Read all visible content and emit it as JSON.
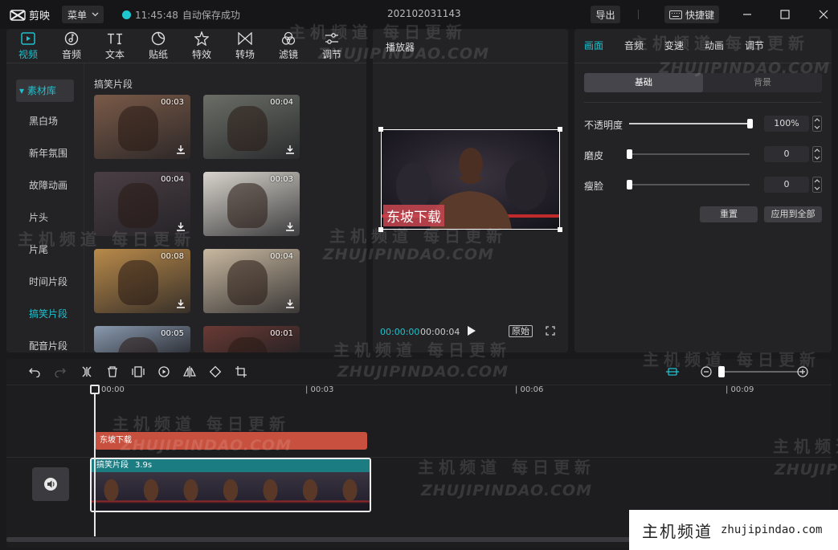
{
  "app": {
    "name": "剪映",
    "menu_label": "菜单",
    "save_time": "11:45:48",
    "save_status": "自动保存成功",
    "project_title": "202102031143",
    "export_label": "导出",
    "shortcut_label": "快捷键"
  },
  "tool_tabs": [
    {
      "label": "视频",
      "icon": "video-icon"
    },
    {
      "label": "音频",
      "icon": "audio-icon"
    },
    {
      "label": "文本",
      "icon": "text-icon"
    },
    {
      "label": "贴纸",
      "icon": "sticker-icon"
    },
    {
      "label": "特效",
      "icon": "effects-icon"
    },
    {
      "label": "转场",
      "icon": "transition-icon"
    },
    {
      "label": "滤镜",
      "icon": "filter-icon"
    },
    {
      "label": "调节",
      "icon": "adjust-icon"
    }
  ],
  "sidebar": {
    "library_label": "素材库",
    "items": [
      "黑白场",
      "新年氛围",
      "故障动画",
      "片头",
      "片尾",
      "时间片段",
      "搞笑片段",
      "配音片段"
    ]
  },
  "media": {
    "section_title": "搞笑片段",
    "clips": [
      {
        "duration": "00:03",
        "color": "#7a5a48"
      },
      {
        "duration": "00:04",
        "color": "#6a6e66"
      },
      {
        "duration": "00:04",
        "color": "#4a3e44"
      },
      {
        "duration": "00:03",
        "color": "#d8d4cc"
      },
      {
        "duration": "00:08",
        "color": "#b98a4a"
      },
      {
        "duration": "00:04",
        "color": "#c8b8a0"
      },
      {
        "duration": "00:05",
        "color": "#8a9ab0"
      },
      {
        "duration": "00:01",
        "color": "#6a3a34"
      }
    ]
  },
  "player": {
    "label": "播放器",
    "caption": "东坡下载",
    "time_current": "00:00:00",
    "time_total": "00:00:04",
    "original_label": "原始"
  },
  "properties": {
    "tabs": [
      "画面",
      "音频",
      "变速",
      "动画",
      "调节"
    ],
    "segment_on": "基础",
    "segment_off": "背景",
    "rows": [
      {
        "label": "不透明度",
        "value": "100%",
        "level": 1.0
      },
      {
        "label": "磨皮",
        "value": "0",
        "level": 0.0
      },
      {
        "label": "瘦脸",
        "value": "0",
        "level": 0.0
      }
    ],
    "reset_label": "重置",
    "apply_all_label": "应用到全部"
  },
  "timeline": {
    "ticks": [
      "00:00",
      "| 00:03",
      "| 00:06",
      "| 00:09"
    ],
    "text_clip_label": "东坡下载",
    "video_clip_name": "搞笑片段",
    "video_clip_duration": "3.9s"
  },
  "watermark": {
    "cn": "主机频道 每日更新",
    "en": "ZHUJIPINDAO.COM",
    "badge_cn": "主机频道",
    "badge_en": "zhujipindao.com"
  },
  "colors": {
    "accent": "#1fc0cc",
    "text_clip": "#c8503e",
    "video_clip": "#1b7c82"
  }
}
